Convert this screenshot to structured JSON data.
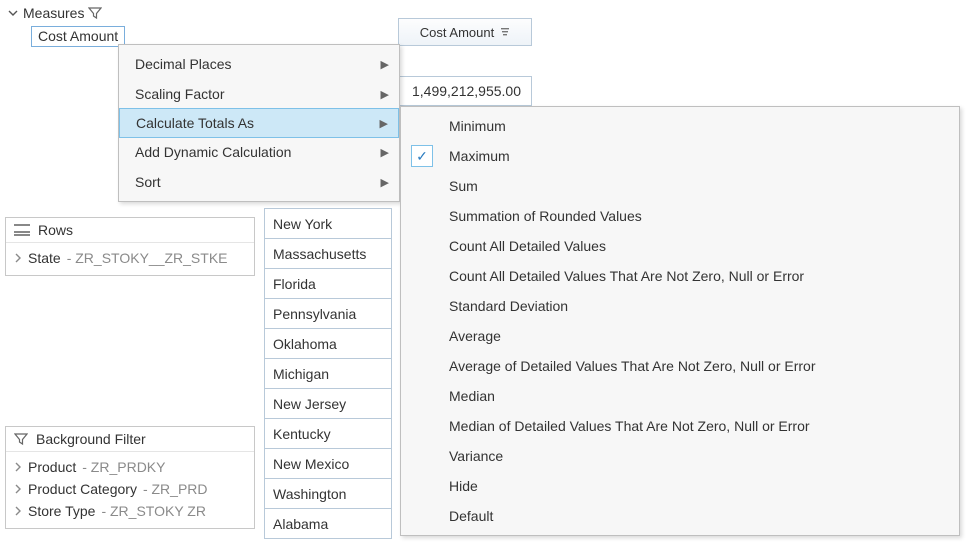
{
  "tree": {
    "root_label": "Measures",
    "selected_measure": "Cost Amount"
  },
  "column": {
    "header": "Cost Amount",
    "value": "1,499,212,955.00"
  },
  "states": [
    "New York",
    "Massachusetts",
    "Florida",
    "Pennsylvania",
    "Oklahoma",
    "Michigan",
    "New Jersey",
    "Kentucky",
    "New Mexico",
    "Washington",
    "Alabama"
  ],
  "rows_panel": {
    "title": "Rows",
    "items": [
      {
        "name": "State",
        "tech": " - ZR_STOKY__ZR_STKE"
      }
    ]
  },
  "filter_panel": {
    "title": "Background Filter",
    "items": [
      {
        "name": "Product",
        "tech": " - ZR_PRDKY"
      },
      {
        "name": "Product Category",
        "tech": " - ZR_PRD"
      },
      {
        "name": "Store Type",
        "tech": " - ZR_STOKY   ZR"
      }
    ]
  },
  "context_menu": {
    "items": [
      {
        "label": "Decimal Places",
        "submenu": true
      },
      {
        "label": "Scaling Factor",
        "submenu": true
      },
      {
        "label": "Calculate Totals As",
        "submenu": true,
        "highlight": true
      },
      {
        "label": "Add Dynamic Calculation",
        "submenu": true
      },
      {
        "label": "Sort",
        "submenu": true
      }
    ]
  },
  "submenu": {
    "checked_index": 1,
    "items": [
      "Minimum",
      "Maximum",
      "Sum",
      "Summation of Rounded Values",
      "Count All Detailed Values",
      "Count All Detailed Values That Are Not Zero, Null or Error",
      "Standard Deviation",
      "Average",
      "Average of Detailed Values That Are Not Zero, Null or Error",
      "Median",
      "Median of Detailed Values That Are Not Zero, Null or Error",
      "Variance",
      "Hide",
      "Default"
    ]
  }
}
